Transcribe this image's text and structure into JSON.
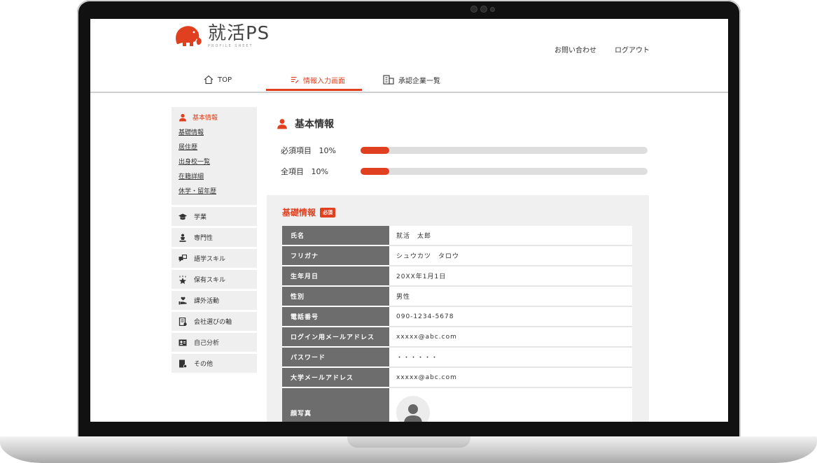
{
  "brand": {
    "name": "就活PS",
    "tagline": "PROFILE SHEET",
    "accent": "#e0401f"
  },
  "header_links": {
    "contact": "お問い合わせ",
    "logout": "ログアウト"
  },
  "nav": {
    "top": "TOP",
    "info_input": "情報入力画面",
    "approved_companies": "承認企業一覧"
  },
  "sidebar": {
    "basic_head": "基本情報",
    "basic_links": [
      "基礎情報",
      "居住歴",
      "出身校一覧",
      "在籍詳細",
      "休学・留年歴"
    ],
    "items": [
      {
        "label": "学業",
        "icon": "graduation-cap-icon"
      },
      {
        "label": "専門性",
        "icon": "person-stand-icon"
      },
      {
        "label": "語学スキル",
        "icon": "chat-bubbles-icon"
      },
      {
        "label": "保有スキル",
        "icon": "star-icon"
      },
      {
        "label": "課外活動",
        "icon": "hand-heart-icon"
      },
      {
        "label": "会社選びの軸",
        "icon": "document-icon"
      },
      {
        "label": "自己分析",
        "icon": "profile-card-icon"
      },
      {
        "label": "その他",
        "icon": "note-icon"
      }
    ]
  },
  "main": {
    "title": "基本情報",
    "progress": [
      {
        "label": "必須項目",
        "value_text": "10%",
        "value": 0.1
      },
      {
        "label": "全項目",
        "value_text": "10%",
        "value": 0.1
      }
    ],
    "panel_title": "基礎情報",
    "required_badge": "必須",
    "rows": [
      {
        "label": "氏名",
        "value": "就活　太郎"
      },
      {
        "label": "フリガナ",
        "value": "シュウカツ　タロウ"
      },
      {
        "label": "生年月日",
        "value": "20XX年1月1日"
      },
      {
        "label": "性別",
        "value": "男性"
      },
      {
        "label": "電話番号",
        "value": "090-1234-5678"
      },
      {
        "label": "ログイン用メールアドレス",
        "value": "xxxxx@abc.com"
      },
      {
        "label": "パスワード",
        "value": "・・・・・・"
      },
      {
        "label": "大学メールアドレス",
        "value": "xxxxx@abc.com"
      }
    ],
    "photo_label": "顔写真"
  }
}
